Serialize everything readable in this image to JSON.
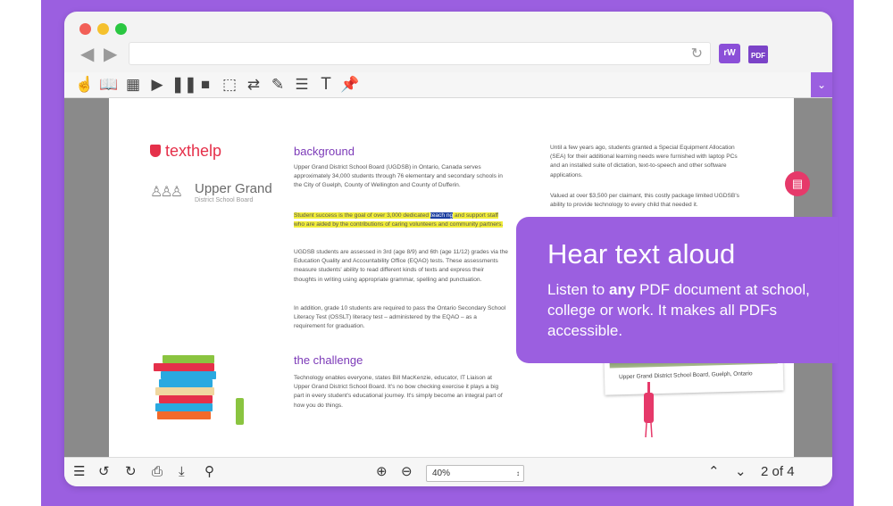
{
  "browser": {
    "extension_rw_label": "rW",
    "extension_pdf_label": "PDF"
  },
  "toolbar": {
    "icons": [
      "hand-pointer-icon",
      "book-icon",
      "image-icon",
      "play-icon",
      "pause-icon",
      "stop-icon",
      "screen-select-icon",
      "shuffle-icon",
      "highlighter-icon",
      "list-icon",
      "text-icon",
      "pin-icon"
    ],
    "dropdown_glyph": "⌄"
  },
  "document": {
    "logo_text": "texthelp",
    "school_name": "Upper Grand",
    "school_sub": "District School Board",
    "background_heading": "background",
    "background_p1": "Upper Grand District School Board (UGDSB) in Ontario, Canada serves approximately 34,000 students through 76 elementary and secondary schools in the City of Guelph, County of Wellington and County of Dufferin.",
    "highlight_before": "Student success is the goal of over 3,000 dedicated ",
    "highlight_word": "teach ng",
    "highlight_after": " and support staff who are aided by the contributions of caring volunteers and community partners.",
    "background_p3": "UGDSB students are assessed in 3rd (age 8/9) and 6th (age 11/12) grades via the Education Quality and Accountability Office (EQAO) tests. These assessments measure students' ability to read different kinds of texts and express their thoughts in writing using appropriate grammar, spelling and punctuation.",
    "background_p4": "In addition, grade 10 students are required to pass the Ontario Secondary School Literacy Test (OSSLT) literacy test – administered by the EQAO – as a requirement for graduation.",
    "challenge_heading": "the challenge",
    "challenge_p1": "Technology enables everyone, states Bill MacKenzie, educator, IT Liaison at Upper Grand District School Board. It's no bow checking exercise it plays a big part in every student's educational journey. It's simply become an integral part of how you do things.",
    "right_p1": "Until a few years ago, students granted a Special Equipment Allocation (SEA) for their additional learning needs were furnished with laptop PCs and an installed suite of dictation, text-to-speech and other software applications.",
    "right_p2": "Valued at over $3,500 per claimant, this costly package limited UGDSB's ability to provide technology to every child that needed it.",
    "photo_caption": "Upper Grand District School Board, Guelph, Ontario"
  },
  "callout": {
    "title": "Hear text aloud",
    "body_before": "Listen to ",
    "body_bold": "any",
    "body_after": " PDF document at school, college or work.  It makes all PDFs accessible."
  },
  "bottom_bar": {
    "zoom_value": "40%",
    "page_current": "2",
    "page_of": "of 4"
  },
  "colors": {
    "brand_purple": "#9b5fe0",
    "highlight_yellow": "#f2ee3a",
    "highlight_word": "#1c3fa0",
    "texthelp_red": "#e5304a"
  }
}
